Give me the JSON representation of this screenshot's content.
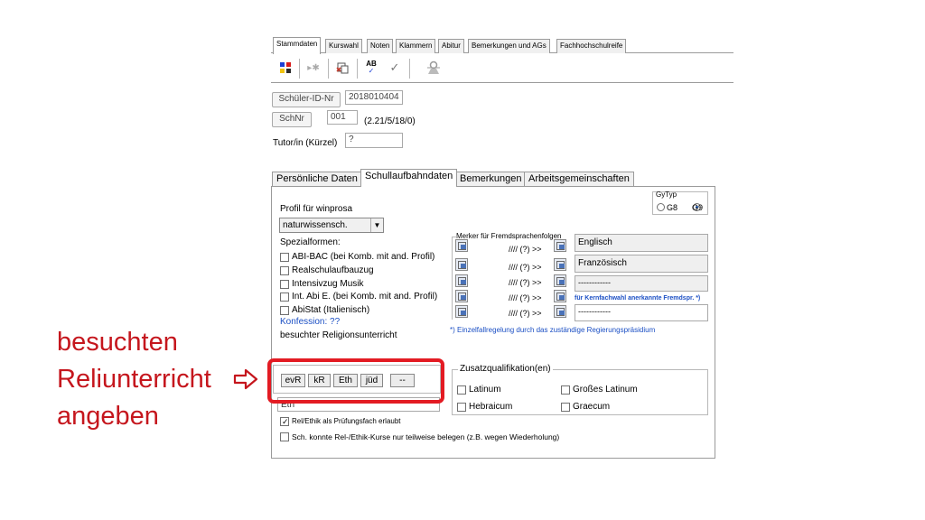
{
  "top_tabs": [
    "Stammdaten",
    "Kurswahl",
    "Noten",
    "Klammern",
    "Abitur",
    "Bemerkungen und AGs",
    "Fachhochschulreife"
  ],
  "header": {
    "id_label": "Schüler-ID-Nr",
    "id_value": "2018010404",
    "schnr_label": "SchNr",
    "schnr_value": "001",
    "schnr_info": "(2.21/5/18/0)",
    "tutor_label": "Tutor/in (Kürzel)",
    "tutor_value": "?"
  },
  "sub_tabs": [
    "Persönliche Daten",
    "Schullaufbahndaten",
    "Bemerkungen",
    "Arbeitsgemeinschaften"
  ],
  "gytyp": {
    "label": "GyTyp",
    "options": [
      "G8",
      "G9"
    ],
    "selected": "G9"
  },
  "profil": {
    "label": "Profil für winprosa",
    "value": "naturwissensch."
  },
  "spezial": {
    "label": "Spezialformen:",
    "items": [
      "ABI-BAC (bei Komb. mit and. Profil)",
      "Realschulaufbauzug",
      "Intensivzug Musik",
      "Int. Abi E. (bei Komb. mit and. Profil)",
      "AbiStat (Italienisch)"
    ]
  },
  "konfession": "Konfession: ??",
  "religion_label": "besuchter Religionsunterricht",
  "religion_buttons": [
    "evR",
    "kR",
    "Eth",
    "jüd",
    "--"
  ],
  "religion_field": "Eth",
  "fremdsprachen": {
    "title": "Merker für Fremdsprachenfolgen",
    "rows": [
      {
        "marker": "//// (?) >>",
        "lang": "Englisch"
      },
      {
        "marker": "//// (?) >>",
        "lang": "Französisch"
      },
      {
        "marker": "//// (?) >>",
        "lang": "------------"
      },
      {
        "marker": "//// (?) >>",
        "lang": ""
      },
      {
        "marker": "//// (?) >>",
        "lang": "------------"
      }
    ],
    "kern_note": "für Kernfachwahl anerkannte Fremdspr. *)",
    "footnote": "*) Einzelfallregelung durch das zuständige Regierungspräsidium"
  },
  "zusatz": {
    "title": "Zusatzqualifikation(en)",
    "items": [
      "Latinum",
      "Großes Latinum",
      "Hebraicum",
      "Graecum"
    ]
  },
  "bottom_checks": [
    {
      "label": "Rel/Ethik als Prüfungsfach erlaubt",
      "checked": true
    },
    {
      "label": "Sch. konnte Rel-/Ethik-Kurse nur teilweise belegen (z.B. wegen Wiederholung)",
      "checked": false
    }
  ],
  "annotation": {
    "line1": "besuchten",
    "line2": "Reliunterricht",
    "line3": "angeben",
    "arrow": "🠊",
    "color": "#c5161d"
  }
}
